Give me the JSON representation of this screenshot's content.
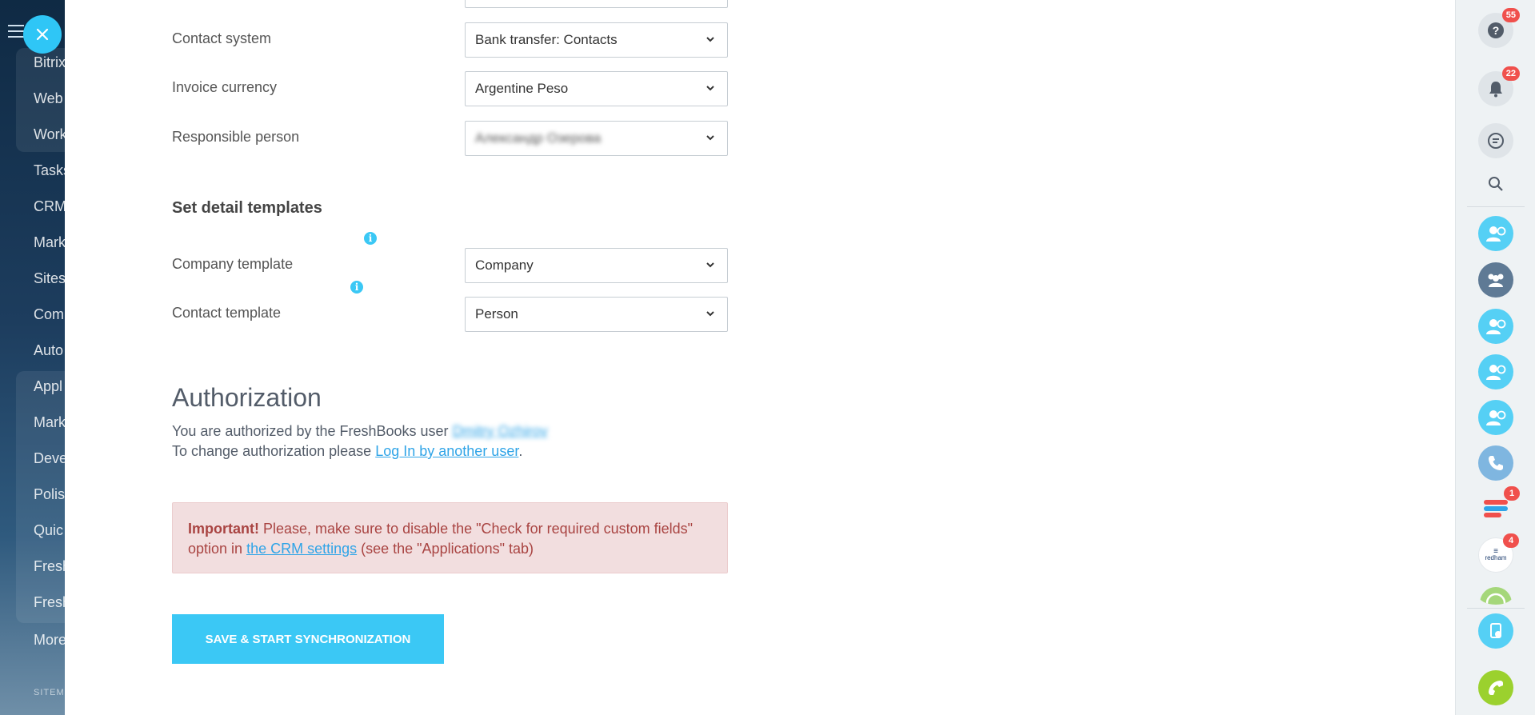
{
  "left_menu": {
    "items": [
      "Bitrix",
      "Web",
      "Work",
      "Tasks",
      "CRM",
      "Mark",
      "Sites",
      "Com",
      "Auto",
      "Appl",
      "Mark",
      "Deve",
      "Polis",
      "Quic",
      "Fresh",
      "Fresh",
      "More"
    ],
    "sitemap_label": "SITEM"
  },
  "form": {
    "contact_system": {
      "label": "Contact system",
      "value": "Bank transfer: Contacts"
    },
    "invoice_currency": {
      "label": "Invoice currency",
      "value": "Argentine Peso"
    },
    "responsible_person": {
      "label": "Responsible person",
      "value": "Александр Озерова"
    }
  },
  "templates": {
    "title": "Set detail templates",
    "company": {
      "label": "Company template",
      "value": "Company",
      "info": "i"
    },
    "contact": {
      "label": "Contact template",
      "value": "Person",
      "info": "i"
    }
  },
  "authorization": {
    "title": "Authorization",
    "line1_prefix": "You are authorized by the FreshBooks user",
    "user_name": "Dmitry Ozhirov",
    "line2_prefix": "To change authorization please",
    "relogin_link": "Log In by another user",
    "line2_suffix": "."
  },
  "alert": {
    "strong": "Important!",
    "text_1": " Please, make sure to disable the \"Check for required custom fields\" option in ",
    "link": "the CRM settings",
    "text_2": " (see the \"Applications\" tab)"
  },
  "save_button": "SAVE & START SYNCHRONIZATION",
  "right_rail": {
    "help_badge": "55",
    "notifications_badge": "22",
    "app1_badge": "1",
    "redham_badge": "4",
    "redham_label": "redham"
  },
  "colors": {
    "accent": "#3bc8f5",
    "alert_bg": "#f2dedf",
    "alert_text": "#a94442",
    "badge": "#f0504c"
  }
}
